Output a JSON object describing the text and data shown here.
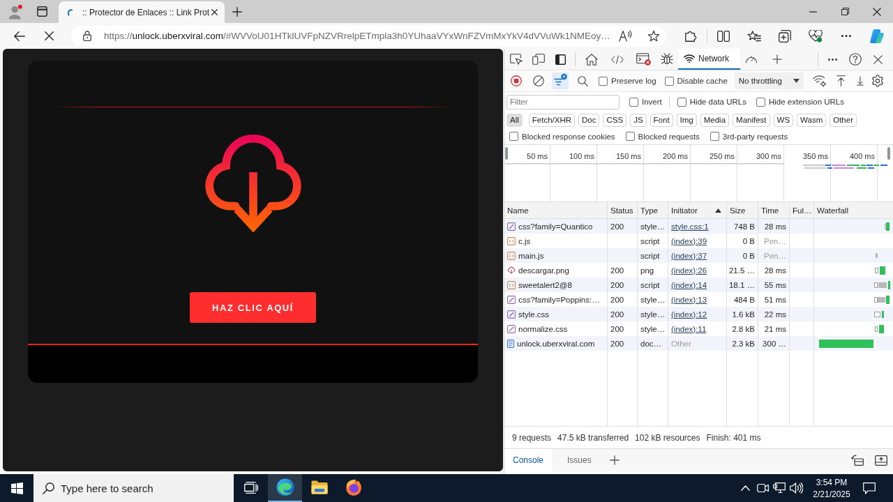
{
  "browser": {
    "tabs": [
      {
        "title": ":: Protector de Enlaces :: Link Prot",
        "selected": true,
        "loading": true
      }
    ],
    "address": {
      "scheme": "https://",
      "host": "unlock.uberxviral.com",
      "rest": "/#WVVoU01HTklUVFpNZVRrelpETmpla3h0YUhaaVYxWnFZVmMxYkV4dVVuWk1NMEoy…"
    }
  },
  "page": {
    "button": "HAZ CLIC AQUÍ"
  },
  "devtools": {
    "panel_tabs": [
      {
        "label": "Network",
        "selected": true
      }
    ],
    "recording": true,
    "filter_on": true,
    "options": [
      {
        "label": "Preserve log",
        "checked": false
      },
      {
        "label": "Disable cache",
        "checked": false
      }
    ],
    "throttling": "No throttling",
    "filter": {
      "placeholder": "Filter"
    },
    "filter_options": [
      {
        "label": "Invert",
        "checked": false
      },
      {
        "label": "Hide data URLs",
        "checked": false
      },
      {
        "label": "Hide extension URLs",
        "checked": false
      }
    ],
    "type_filters": [
      {
        "label": "All",
        "selected": true
      },
      {
        "label": "Fetch/XHR",
        "selected": false
      },
      {
        "label": "Doc",
        "selected": false
      },
      {
        "label": "CSS",
        "selected": false
      },
      {
        "label": "JS",
        "selected": false
      },
      {
        "label": "Font",
        "selected": false
      },
      {
        "label": "Img",
        "selected": false
      },
      {
        "label": "Media",
        "selected": false
      },
      {
        "label": "Manifest",
        "selected": false
      },
      {
        "label": "WS",
        "selected": false
      },
      {
        "label": "Wasm",
        "selected": false
      },
      {
        "label": "Other",
        "selected": false
      }
    ],
    "request_options": [
      {
        "label": "Blocked response cookies",
        "checked": false
      },
      {
        "label": "Blocked requests",
        "checked": false
      },
      {
        "label": "3rd-party requests",
        "checked": false
      }
    ],
    "overview": {
      "ticks": [
        "50 ms",
        "100 ms",
        "150 ms",
        "200 ms",
        "250 ms",
        "300 ms",
        "350 ms",
        "400 ms"
      ]
    },
    "table": {
      "columns": [
        {
          "label": "Name",
          "sorted": false
        },
        {
          "label": "Status",
          "sorted": false
        },
        {
          "label": "Type",
          "sorted": false
        },
        {
          "label": "Initiator",
          "sorted": true
        },
        {
          "label": "Size",
          "sorted": false
        },
        {
          "label": "Time",
          "sorted": false
        },
        {
          "label": "Ful…",
          "sorted": false
        },
        {
          "label": "Waterfall",
          "sorted": false
        }
      ],
      "rows": [
        {
          "kind": "stylesheet",
          "name": "css?family=Quantico",
          "status": "200",
          "type": "style…",
          "initiator": "style.css:1",
          "initiator_link": true,
          "size": "748 B",
          "time": "28 ms",
          "pending": false
        },
        {
          "kind": "script",
          "name": "c.js",
          "type": "script",
          "initiator": "(index):39",
          "initiator_link": true,
          "size": "0 B",
          "time": "Pen…",
          "pending": true
        },
        {
          "kind": "script",
          "name": "main.js",
          "type": "script",
          "initiator": "(index):37",
          "initiator_link": true,
          "size": "0 B",
          "time": "Pen…",
          "pending": true
        },
        {
          "kind": "image",
          "name": "descargar.png",
          "status": "200",
          "type": "png",
          "initiator": "(index):26",
          "initiator_link": true,
          "size": "21.5 …",
          "time": "28 ms",
          "pending": false
        },
        {
          "kind": "script",
          "name": "sweetalert2@8",
          "status": "200",
          "type": "script",
          "initiator": "(index):14",
          "initiator_link": true,
          "size": "18.1 …",
          "time": "55 ms",
          "pending": false
        },
        {
          "kind": "stylesheet",
          "name": "css?family=Poppins:…",
          "status": "200",
          "type": "style…",
          "initiator": "(index):13",
          "initiator_link": true,
          "size": "484 B",
          "time": "51 ms",
          "pending": false
        },
        {
          "kind": "stylesheet",
          "name": "style.css",
          "status": "200",
          "type": "style…",
          "initiator": "(index):12",
          "initiator_link": true,
          "size": "1.6 kB",
          "time": "22 ms",
          "pending": false
        },
        {
          "kind": "stylesheet",
          "name": "normalize.css",
          "status": "200",
          "type": "style…",
          "initiator": "(index):11",
          "initiator_link": true,
          "size": "2.8 kB",
          "time": "21 ms",
          "pending": false
        },
        {
          "kind": "document",
          "name": "unlock.uberxviral.com",
          "status": "200",
          "type": "doc…",
          "initiator": "Other",
          "initiator_link": false,
          "size": "2.3 kB",
          "time": "300 …",
          "pending": false
        }
      ]
    },
    "summary": [
      "9 requests",
      "47.5 kB transferred",
      "102 kB resources",
      "Finish: 401 ms"
    ],
    "drawer_tabs": [
      {
        "label": "Console",
        "selected": true
      },
      {
        "label": "Issues",
        "selected": false
      }
    ]
  },
  "taskbar": {
    "search": {
      "placeholder": "Type here to search"
    },
    "apps": [
      {
        "kind": "task-view",
        "selected": false
      },
      {
        "kind": "browser",
        "selected": true
      },
      {
        "kind": "folder",
        "selected": false
      },
      {
        "kind": "fox",
        "selected": false
      }
    ],
    "clock": {
      "time": "3:54 PM",
      "date": "2/21/2025"
    }
  }
}
